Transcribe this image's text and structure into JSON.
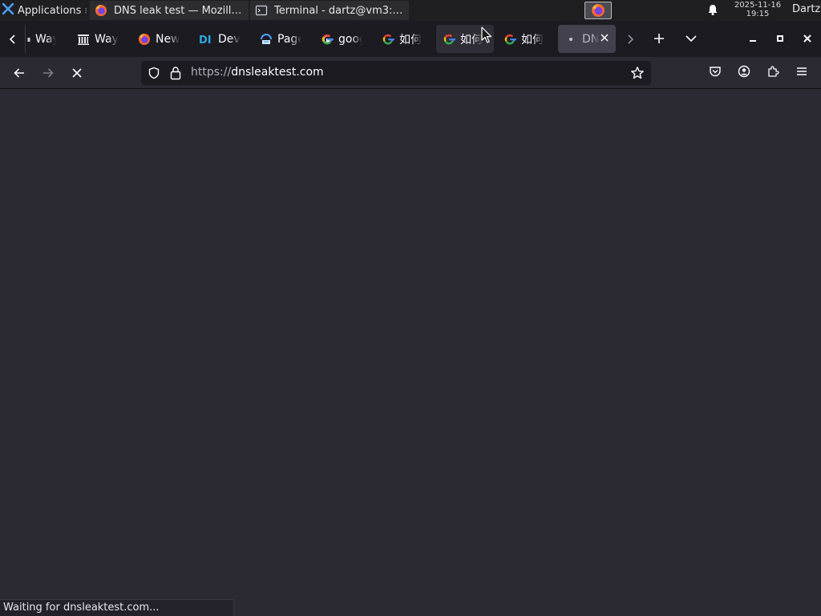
{
  "os_panel": {
    "apps_label": "Applications",
    "tasks": [
      {
        "label": "DNS leak test — Mozilla...",
        "icon": "firefox-icon"
      },
      {
        "label": "Terminal - dartz@vm3: ...",
        "icon": "terminal-icon"
      }
    ],
    "clock": {
      "date": "2025-11-16",
      "time": "19:15"
    },
    "user": "Dartz"
  },
  "tabs": [
    {
      "title": "Wayl",
      "icon": "wayback-icon"
    },
    {
      "title": "Wayl",
      "icon": "archive-icon"
    },
    {
      "title": "New",
      "icon": "firefox-icon"
    },
    {
      "title": "Devi",
      "icon": "di-icon"
    },
    {
      "title": "Page",
      "icon": "page-icon"
    },
    {
      "title": "goog",
      "icon": "google-icon"
    },
    {
      "title": "如何",
      "icon": "google-icon"
    },
    {
      "title": "如何",
      "icon": "google-icon",
      "hovered": true
    },
    {
      "title": "如何",
      "icon": "google-icon"
    },
    {
      "title": "DN",
      "icon": "loading-dot-icon",
      "selected": true
    }
  ],
  "navbar": {
    "url_scheme": "https://",
    "url_host": "dnsleaktest.com"
  },
  "status": "Waiting for dnsleaktest.com...",
  "colors": {
    "toolbar": "#2b2a33",
    "tabbar": "#1c1b22",
    "urlbar": "#1c1b22",
    "selected_tab": "#42414d",
    "panel": "#1f1f22"
  }
}
